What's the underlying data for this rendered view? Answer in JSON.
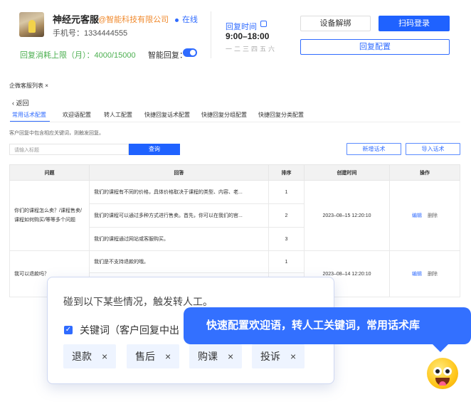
{
  "profile": {
    "name": "神经元客服",
    "company": "@智能科技有限公司",
    "status": "在线",
    "phone": "手机号：1334444555",
    "reply_limit": "回复消耗上限（月）：4000/15000",
    "smart_reply": "智能回复："
  },
  "reply_time": {
    "label": "回复时间",
    "value": "9:00–18:00",
    "days": "一二三四五六"
  },
  "actions": {
    "unbind": "设备解绑",
    "scan_login": "扫码登录",
    "reply_config": "回复配置"
  },
  "section_title": "企微客服列表 ×",
  "back": "返回",
  "tabs": [
    "常用话术配置",
    "欢迎语配置",
    "转人工配置",
    "快捷回复话术配置",
    "快捷回复分组配置",
    "快捷回复分类配置"
  ],
  "hint": "客户回复中包含相应关键词，则触发回复。",
  "search": {
    "placeholder": "请输入标题",
    "button": "查询"
  },
  "buttons": {
    "add": "新增话术",
    "import": "导入话术"
  },
  "table": {
    "headers": [
      "问题",
      "回答",
      "排序",
      "创建时间",
      "操作"
    ],
    "groups": [
      {
        "question": "你们的课程怎么卖？/课程售卖/课程如何购买/等等多个问题",
        "time": "2023–08–15 12:20:10",
        "edit": "编辑",
        "delete": "删除",
        "answers": [
          {
            "text": "我们的课程有不同的价格，具体价格取决于课程的类型、内容、老...",
            "order": "1"
          },
          {
            "text": "我们的课程可以通过多种方式进行售卖。首先，你可以在我们的官...",
            "order": "2"
          },
          {
            "text": "我们的课程通过网站或客服购买。",
            "order": "3"
          }
        ]
      },
      {
        "question": "我可以退款吗？",
        "time": "2023–08–14 12:20:10",
        "edit": "编辑",
        "delete": "删除",
        "answers": [
          {
            "text": "我们是不支持退款的哦。",
            "order": "1"
          },
          {
            "text": "",
            "order": ""
          }
        ]
      }
    ]
  },
  "popup": {
    "title": "碰到以下某些情况，触发转人工。",
    "keyword_label": "关键词（客户回复中出",
    "chips": [
      "退款",
      "售后",
      "购课",
      "投诉"
    ],
    "chip_close": "×"
  },
  "callout": "快速配置欢迎语，转人工关键词，常用话术库",
  "colors": {
    "accent": "#1f62ff",
    "warn": "#f08a2e",
    "ok": "#4caf50"
  }
}
